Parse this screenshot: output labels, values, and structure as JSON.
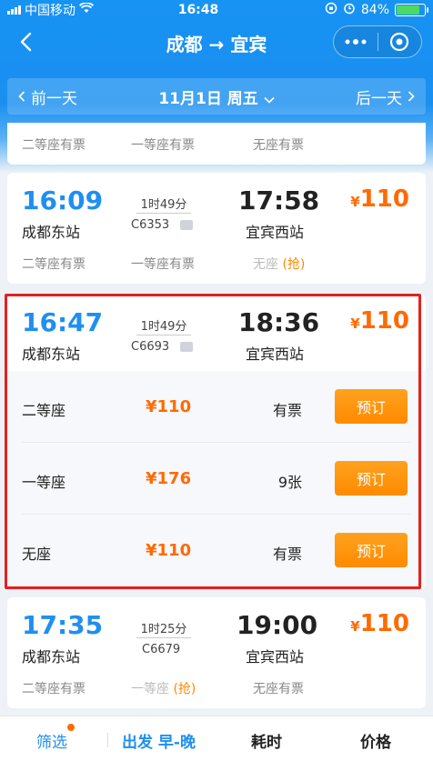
{
  "status_bar": {
    "carrier": "中国移动",
    "time": "16:48",
    "battery": "84%",
    "battery_level": 0.84
  },
  "nav": {
    "title": "成都 → 宜宾",
    "back_icon": "chevron-left-icon",
    "more_icon": "more-dots-icon",
    "close_icon": "target-circle-icon"
  },
  "date_bar": {
    "prev_label": "前一天",
    "current_date": "11月1日 周五",
    "next_label": "后一天"
  },
  "colors": {
    "brand_blue": "#1f8ff0",
    "price_orange": "#ff6a00",
    "button_orange": "#ff8a00",
    "highlight_red": "#e62020"
  },
  "trains": [
    {
      "seats_summary": [
        "二等座有票",
        "一等座有票",
        "无座有票"
      ]
    },
    {
      "dep_time": "16:09",
      "dep_station": "成都东站",
      "duration": "1时49分",
      "train_no": "C6353",
      "arr_time": "17:58",
      "arr_station": "宜宾西站",
      "currency": "¥",
      "price": "110",
      "seats_summary": [
        "二等座有票",
        "一等座有票",
        "无座"
      ],
      "grab_label": "(抢)"
    },
    {
      "dep_time": "16:47",
      "dep_station": "成都东站",
      "duration": "1时49分",
      "train_no": "C6693",
      "arr_time": "18:36",
      "arr_station": "宜宾西站",
      "currency": "¥",
      "price": "110",
      "seat_options": [
        {
          "name": "二等座",
          "price": "¥110",
          "availability": "有票",
          "button": "预订"
        },
        {
          "name": "一等座",
          "price": "¥176",
          "availability": "9张",
          "button": "预订"
        },
        {
          "name": "无座",
          "price": "¥110",
          "availability": "有票",
          "button": "预订"
        }
      ]
    },
    {
      "dep_time": "17:35",
      "dep_station": "成都东站",
      "duration": "1时25分",
      "train_no": "C6679",
      "arr_time": "19:00",
      "arr_station": "宜宾西站",
      "currency": "¥",
      "price": "110",
      "seats_summary": [
        "二等座有票",
        "一等座",
        "无座有票"
      ],
      "grab_label": "(抢)"
    }
  ],
  "tab_bar": {
    "filter": "筛选",
    "depart": "出发 早-晚",
    "duration": "耗时",
    "price": "价格"
  }
}
